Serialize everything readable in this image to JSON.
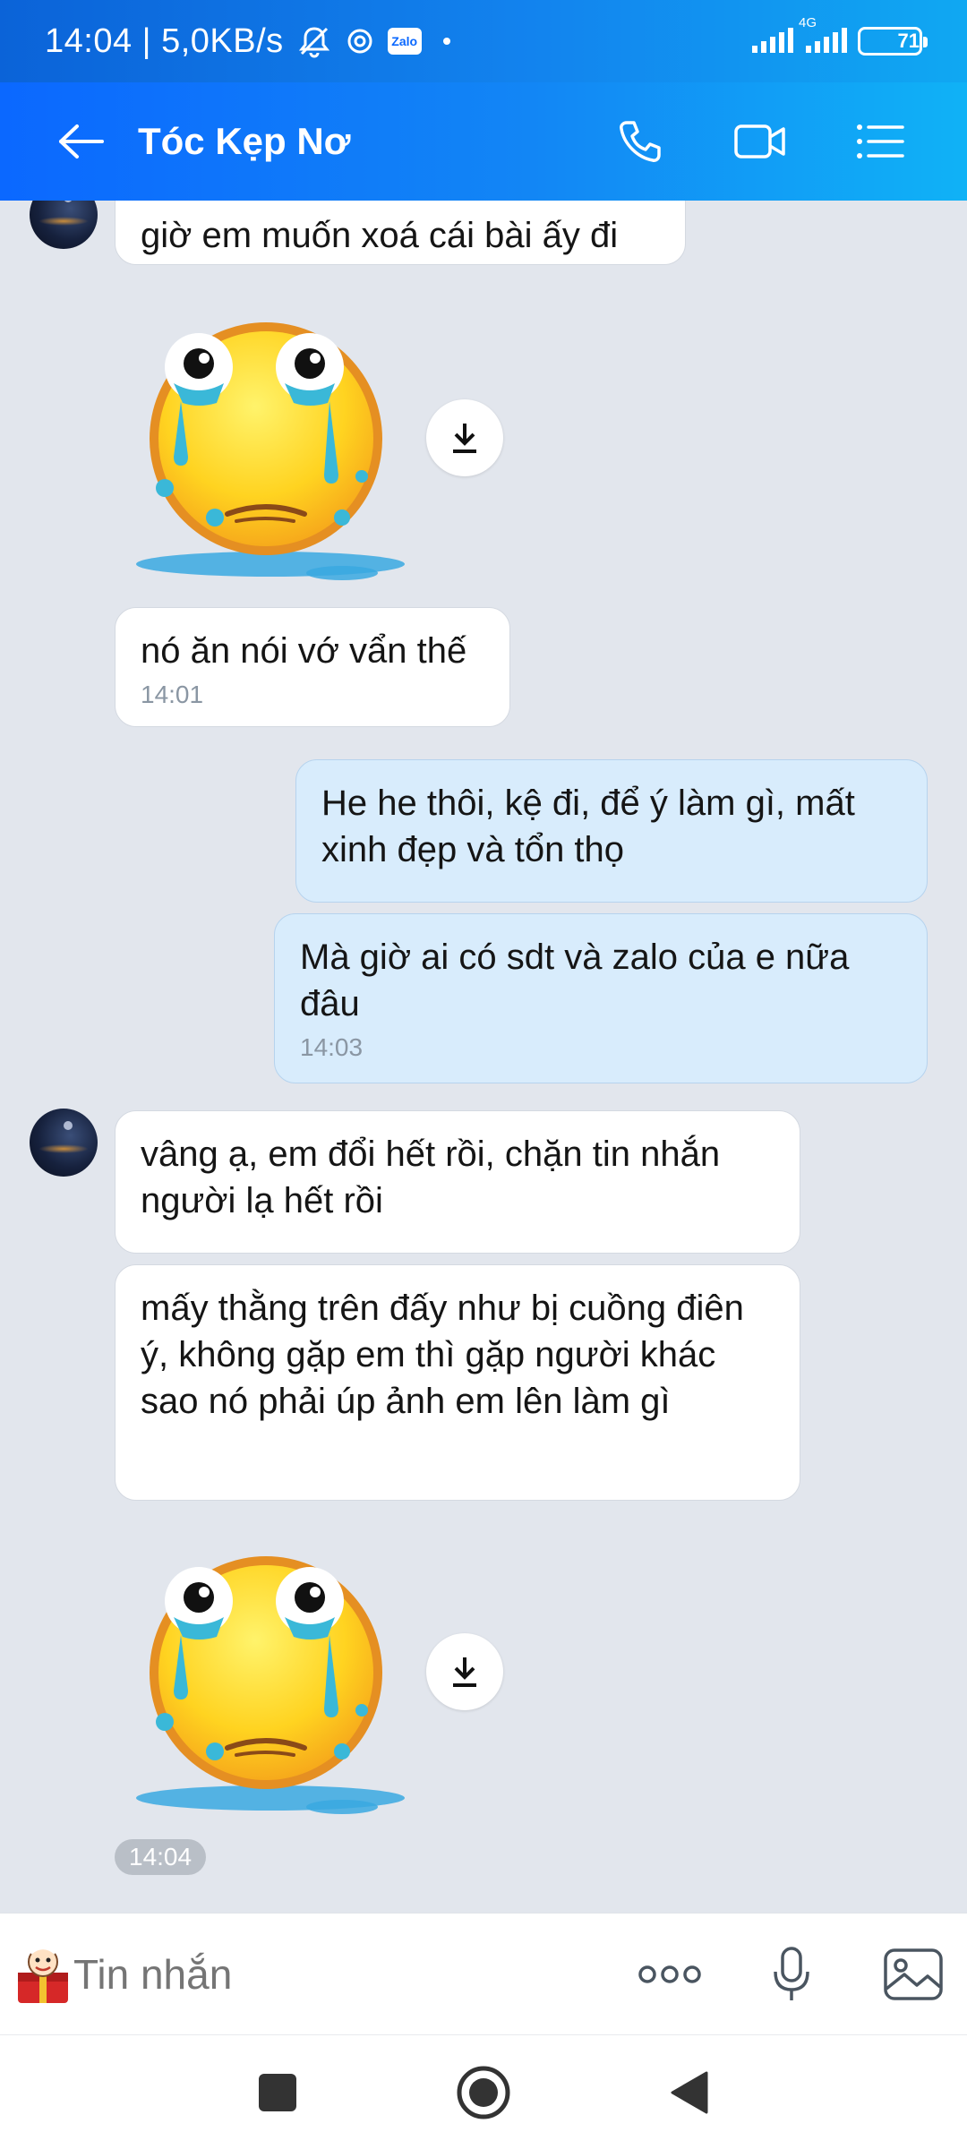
{
  "status_bar": {
    "time_speed": "14:04 | 5,0KB/s",
    "network": "4G",
    "battery": "71",
    "battery_level_pct": 71
  },
  "header": {
    "title": "Tóc Kẹp Nơ",
    "icons": [
      "back-arrow-icon",
      "phone-icon",
      "video-call-icon",
      "menu-list-icon"
    ]
  },
  "messages": [
    {
      "side": "in",
      "text": "giờ em muốn xoá cái bài ấy đi"
    },
    {
      "side": "in",
      "type": "sticker",
      "sticker": "crying-face-sticker"
    },
    {
      "side": "in",
      "text": "nó ăn nói vớ vẩn thế",
      "time": "14:01"
    },
    {
      "side": "out",
      "text": "He he thôi, kệ đi, để ý làm gì, mất xinh đẹp và tổn thọ"
    },
    {
      "side": "out",
      "text": "Mà giờ ai có sdt và zalo của e nữa đâu",
      "time": "14:03"
    },
    {
      "side": "in",
      "text": "vâng ạ, em đổi hết rồi, chặn tin nhắn người lạ hết rồi"
    },
    {
      "side": "in",
      "text": "mấy thằng trên đấy như bị cuồng điên ý, không gặp em thì gặp người khác sao nó phải úp ảnh em lên làm gì"
    },
    {
      "side": "in",
      "type": "sticker",
      "sticker": "crying-face-sticker",
      "time": "14:04"
    }
  ],
  "input": {
    "placeholder": "Tin nhắn"
  },
  "colors": {
    "header_start": "#0b68ff",
    "header_end": "#10b2f6",
    "bubble_in": "#ffffff",
    "bubble_out": "#d8ecfc",
    "chat_bg": "#e2e6ed"
  }
}
